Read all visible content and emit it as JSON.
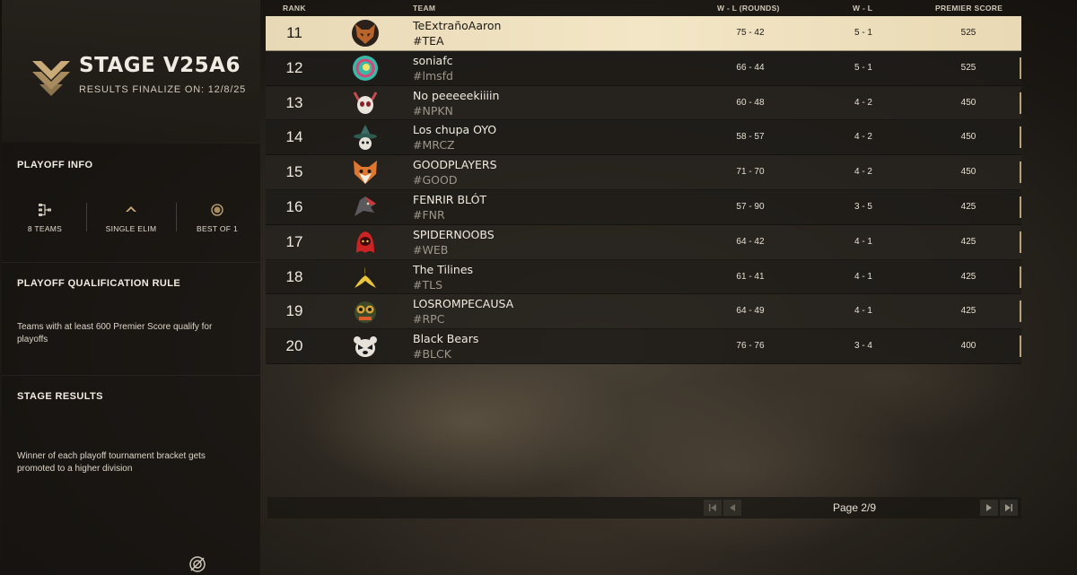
{
  "stage": {
    "title": "STAGE V25A6",
    "finalize": "RESULTS FINALIZE ON: 12/8/25"
  },
  "playoff_info": {
    "heading": "PLAYOFF INFO",
    "stats": [
      {
        "label": "8 TEAMS",
        "icon": "bracket-icon"
      },
      {
        "label": "SINGLE ELIM",
        "icon": "chevron-up-icon"
      },
      {
        "label": "BEST OF 1",
        "icon": "circle-dot-icon"
      }
    ]
  },
  "qualification": {
    "heading": "PLAYOFF QUALIFICATION RULE",
    "text": "Teams with at least 600 Premier Score qualify for playoffs"
  },
  "stage_results": {
    "heading": "STAGE RESULTS",
    "text": "Winner of each playoff tournament bracket gets promoted to a higher division"
  },
  "table": {
    "headers": {
      "rank": "RANK",
      "team": "TEAM",
      "rounds": "W - L (ROUNDS)",
      "wl": "W - L",
      "score": "PREMIER SCORE"
    },
    "rows": [
      {
        "rank": "11",
        "name": "TeExtrañoAaron",
        "tag": "#TEA",
        "rounds": "75 - 42",
        "wl": "5 - 1",
        "score": "525",
        "logo": "fox-mask-icon",
        "color": "#b8642a",
        "highlight": true
      },
      {
        "rank": "12",
        "name": "soniafc",
        "tag": "#lmsfd",
        "rounds": "66 - 44",
        "wl": "5 - 1",
        "score": "525",
        "logo": "swirl-icon",
        "color": "#39b8a8",
        "highlight": false
      },
      {
        "rank": "13",
        "name": "No peeeeekiiiin",
        "tag": "#NPKN",
        "rounds": "60 - 48",
        "wl": "4 - 2",
        "score": "450",
        "logo": "horned-skull-icon",
        "color": "#c94a52",
        "highlight": false
      },
      {
        "rank": "14",
        "name": "Los chupa OYO",
        "tag": "#MRCZ",
        "rounds": "58 - 57",
        "wl": "4 - 2",
        "score": "450",
        "logo": "witch-hat-icon",
        "color": "#5fb3a0",
        "highlight": false
      },
      {
        "rank": "15",
        "name": "GOODPLAYERS",
        "tag": "#GOOD",
        "rounds": "71 - 70",
        "wl": "4 - 2",
        "score": "450",
        "logo": "fox-face-icon",
        "color": "#e0772f",
        "highlight": false
      },
      {
        "rank": "16",
        "name": "FENRIR BLÓT",
        "tag": "#FNR",
        "rounds": "57 - 90",
        "wl": "3 - 5",
        "score": "425",
        "logo": "wolf-head-icon",
        "color": "#d0373c",
        "highlight": false
      },
      {
        "rank": "17",
        "name": "SPIDERNOOBS",
        "tag": "#WEB",
        "rounds": "64 - 42",
        "wl": "4 - 1",
        "score": "425",
        "logo": "hooded-ghost-icon",
        "color": "#cc2424",
        "highlight": false
      },
      {
        "rank": "18",
        "name": "The Tilines",
        "tag": "#TLS",
        "rounds": "61 - 41",
        "wl": "4 - 1",
        "score": "425",
        "logo": "banana-icon",
        "color": "#e8c53a",
        "highlight": false
      },
      {
        "rank": "19",
        "name": "LOSROMPECAUSA",
        "tag": "#RPC",
        "rounds": "64 - 49",
        "wl": "4 - 1",
        "score": "425",
        "logo": "owl-icon",
        "color": "#d9a437",
        "highlight": false
      },
      {
        "rank": "20",
        "name": "Black Bears",
        "tag": "#BLCK",
        "rounds": "76 - 76",
        "wl": "3 - 4",
        "score": "400",
        "logo": "bear-icon",
        "color": "#e6e2da",
        "highlight": false
      }
    ]
  },
  "pager": {
    "label": "Page 2/9"
  },
  "colors": {
    "accent": "#c9ab7a",
    "highlight_row": "#efe1c0"
  }
}
